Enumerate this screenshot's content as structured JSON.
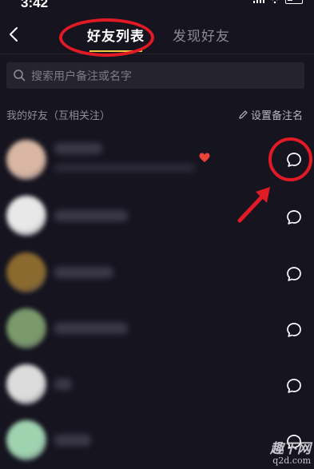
{
  "status_bar": {
    "time": "3:42"
  },
  "header": {
    "tabs": [
      {
        "label": "好友列表",
        "active": true
      },
      {
        "label": "发现好友",
        "active": false
      }
    ],
    "accent_color": "#f3c942"
  },
  "search": {
    "placeholder": "搜索用户备注或名字"
  },
  "section": {
    "label": "我的好友（互相关注）",
    "action_label": "设置备注名"
  },
  "friends": [
    {
      "avatar_color": "#d9b7a4",
      "has_heart": true
    },
    {
      "avatar_color": "#e8e8e8",
      "has_heart": false
    },
    {
      "avatar_color": "#8a6a2e",
      "has_heart": false
    },
    {
      "avatar_color": "#7a9a6b",
      "has_heart": false
    },
    {
      "avatar_color": "#dcdcdc",
      "has_heart": false
    },
    {
      "avatar_color": "#9fd3b0",
      "has_heart": false
    }
  ],
  "annotation_color": "#e11a25",
  "watermark": {
    "main": "趣下网",
    "sub": "q2d.com"
  }
}
